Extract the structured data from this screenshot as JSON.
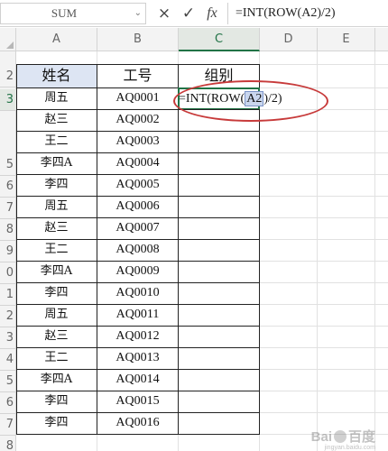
{
  "formula_bar": {
    "name_box": "SUM",
    "cancel_icon": "×",
    "confirm_icon": "✓",
    "fx_label": "fx",
    "formula": "=INT(ROW(A2)/2)"
  },
  "columns": [
    "A",
    "B",
    "C",
    "D",
    "E"
  ],
  "rows": [
    "2",
    "3",
    "4",
    "5",
    "6",
    "7",
    "8",
    "9",
    "10",
    "11",
    "12",
    "13",
    "14",
    "15",
    "16",
    "17",
    "18"
  ],
  "row_labels_visible": [
    "2",
    "3",
    "5",
    "6",
    "7",
    "8",
    "9",
    "0",
    "1",
    "2",
    "3",
    "4",
    "5",
    "6",
    "7",
    "8"
  ],
  "headers": {
    "name": "姓名",
    "id": "工号",
    "group": "组别"
  },
  "formula_cell": {
    "prefix": "=INT(ROW(",
    "ref": "A2",
    "suffix": ")/2)"
  },
  "table": [
    {
      "name": "周五",
      "id": "AQ0001"
    },
    {
      "name": "赵三",
      "id": "AQ0002"
    },
    {
      "name": "王二",
      "id": "AQ0003"
    },
    {
      "name": "李四A",
      "id": "AQ0004"
    },
    {
      "name": "李四",
      "id": "AQ0005"
    },
    {
      "name": "周五",
      "id": "AQ0006"
    },
    {
      "name": "赵三",
      "id": "AQ0007"
    },
    {
      "name": "王二",
      "id": "AQ0008"
    },
    {
      "name": "李四A",
      "id": "AQ0009"
    },
    {
      "name": "李四",
      "id": "AQ0010"
    },
    {
      "name": "周五",
      "id": "AQ0011"
    },
    {
      "name": "赵三",
      "id": "AQ0012"
    },
    {
      "name": "王二",
      "id": "AQ0013"
    },
    {
      "name": "李四A",
      "id": "AQ0014"
    },
    {
      "name": "李四",
      "id": "AQ0015"
    },
    {
      "name": "李四",
      "id": "AQ0016"
    }
  ],
  "watermark": {
    "text": "Bai",
    "text2": "百度",
    "sub": "jingyan.baidu.com"
  },
  "colors": {
    "accent": "#217346",
    "header_fill": "#dde5f3",
    "annotation": "#c73a3a"
  }
}
